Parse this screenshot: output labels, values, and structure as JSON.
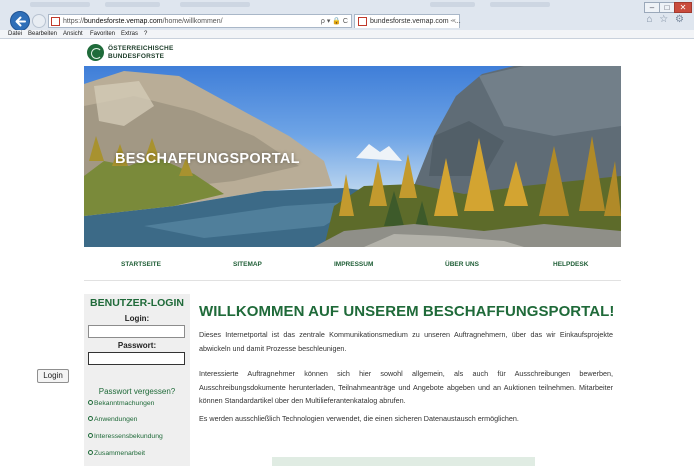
{
  "browser": {
    "url_scheme": "https://",
    "url_host": "bundesforste.vemap.com",
    "url_path": "/home/willkommen/",
    "address_tools": "ρ ▾ 🔒 C",
    "tab_title": "bundesforste.vemap.com - ...",
    "tab_close": "×",
    "window_controls": [
      "–",
      "□",
      "✕"
    ],
    "toolbar_icons": "⌂ ☆ ⚙",
    "menu": [
      "Datei",
      "Bearbeiten",
      "Ansicht",
      "Favoriten",
      "Extras",
      "?"
    ]
  },
  "logo": {
    "line1": "ÖSTERREICHISCHE",
    "line2": "BUNDESFORSTE"
  },
  "banner": {
    "title": "BESCHAFFUNGSPORTAL"
  },
  "nav": [
    "STARTSEITE",
    "SITEMAP",
    "IMPRESSUM",
    "ÜBER UNS",
    "HELPDESK"
  ],
  "sidebar": {
    "title": "BENUTZER-LOGIN",
    "login_label": "Login:",
    "login_value": "",
    "password_label": "Passwort:",
    "password_value": "",
    "login_button": "Login",
    "forgot_password": "Passwort vergessen?",
    "links": [
      "Bekanntmachungen",
      "Anwendungen",
      "Interessensbekundung",
      "Zusammenarbeit"
    ]
  },
  "main": {
    "title": "WILLKOMMEN AUF UNSEREM BESCHAFFUNGSPORTAL!",
    "paragraphs": [
      "Dieses Internetportal ist das zentrale Kommunikationsmedium zu unseren Auftragnehmern, über das wir Einkaufsprojekte abwickeln und damit Prozesse beschleunigen.",
      "Interessierte Auftragnehmer können sich hier sowohl allgemein, als auch für Ausschreibungen bewerben, Ausschreibungsdokumente herunterladen, Teilnahmeanträge und Angebote abgeben und an Auktionen teilnehmen. Mitarbeiter können Standardartikel über den Multilieferantenkatalog abrufen.",
      "Es werden ausschließlich Technologien verwendet, die einen sicheren Datenaustausch ermöglichen."
    ]
  },
  "colors": {
    "brand_green": "#1f6a39",
    "sidebar_bg": "#efefef",
    "chrome_bg": "#dfe6ef"
  }
}
